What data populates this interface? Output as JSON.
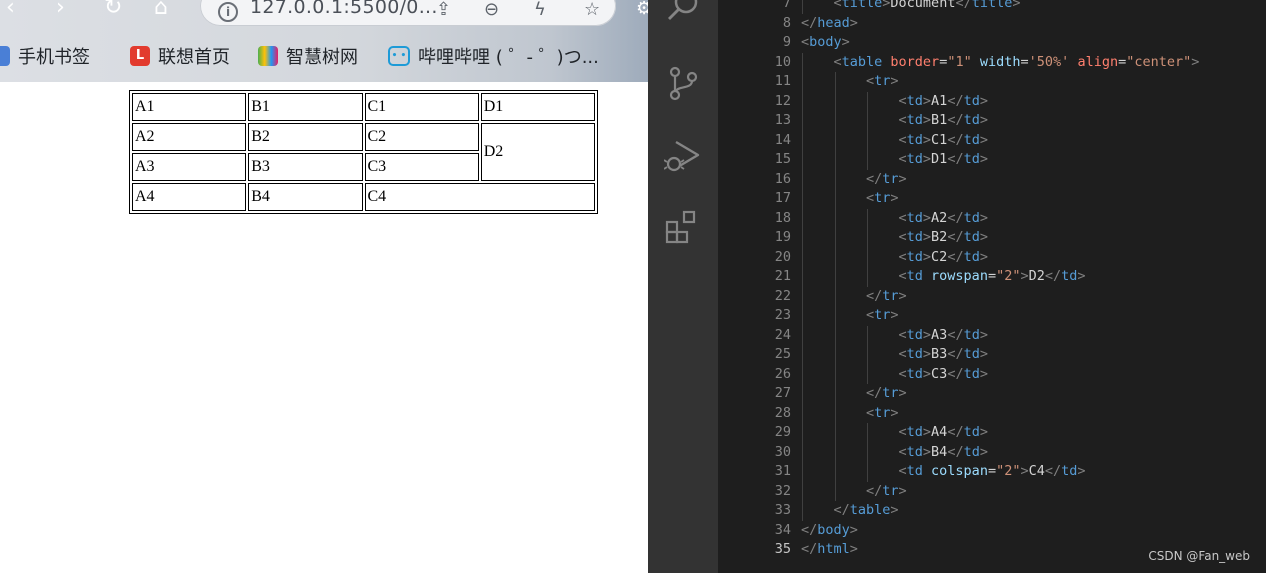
{
  "browser": {
    "url": "127.0.0.1:5500/0...",
    "bookmarks": [
      {
        "label": "手机书签",
        "icon": "bookmark-icon"
      },
      {
        "label": "联想首页",
        "icon": "lenovo-icon",
        "glyph": "L"
      },
      {
        "label": "智慧树网",
        "icon": "zhihuishu-icon"
      },
      {
        "label": "哔哩哔哩 ( ゜- ゜)つ...",
        "icon": "bilibili-icon",
        "glyph": "• •"
      }
    ],
    "table": {
      "rows": [
        [
          "A1",
          "B1",
          "C1",
          "D1"
        ],
        [
          "A2",
          "B2",
          "C2",
          "D2"
        ],
        [
          "A3",
          "B3",
          "C3"
        ],
        [
          "A4",
          "B4",
          "C4"
        ]
      ]
    }
  },
  "editor": {
    "current_line": "35",
    "lines": [
      {
        "no": "7",
        "indent": 1,
        "tokens": [
          [
            "brk",
            "<"
          ],
          [
            "tag",
            "title"
          ],
          [
            "brk",
            ">"
          ],
          [
            "text",
            "Document"
          ],
          [
            "brk",
            "</"
          ],
          [
            "tag",
            "title"
          ],
          [
            "brk",
            ">"
          ]
        ]
      },
      {
        "no": "8",
        "indent": 0,
        "tokens": [
          [
            "brk",
            "</"
          ],
          [
            "tag",
            "head"
          ],
          [
            "brk",
            ">"
          ]
        ]
      },
      {
        "no": "9",
        "indent": 0,
        "tokens": [
          [
            "brk",
            "<"
          ],
          [
            "tag",
            "body"
          ],
          [
            "brk",
            ">"
          ]
        ]
      },
      {
        "no": "10",
        "indent": 1,
        "tokens": [
          [
            "brk",
            "<"
          ],
          [
            "tag",
            "table"
          ],
          [
            "text",
            " "
          ],
          [
            "attr",
            "border"
          ],
          [
            "text",
            "="
          ],
          [
            "str",
            "\"1\""
          ],
          [
            "text",
            " "
          ],
          [
            "attr2",
            "width"
          ],
          [
            "text",
            "="
          ],
          [
            "str",
            "'50%'"
          ],
          [
            "text",
            " "
          ],
          [
            "attr",
            "align"
          ],
          [
            "text",
            "="
          ],
          [
            "str",
            "\"center\""
          ],
          [
            "brk",
            ">"
          ]
        ]
      },
      {
        "no": "11",
        "indent": 2,
        "tokens": [
          [
            "brk",
            "<"
          ],
          [
            "tag",
            "tr"
          ],
          [
            "brk",
            ">"
          ]
        ]
      },
      {
        "no": "12",
        "indent": 3,
        "tokens": [
          [
            "brk",
            "<"
          ],
          [
            "tag",
            "td"
          ],
          [
            "brk",
            ">"
          ],
          [
            "text",
            "A1"
          ],
          [
            "brk",
            "</"
          ],
          [
            "tag",
            "td"
          ],
          [
            "brk",
            ">"
          ]
        ]
      },
      {
        "no": "13",
        "indent": 3,
        "tokens": [
          [
            "brk",
            "<"
          ],
          [
            "tag",
            "td"
          ],
          [
            "brk",
            ">"
          ],
          [
            "text",
            "B1"
          ],
          [
            "brk",
            "</"
          ],
          [
            "tag",
            "td"
          ],
          [
            "brk",
            ">"
          ]
        ]
      },
      {
        "no": "14",
        "indent": 3,
        "tokens": [
          [
            "brk",
            "<"
          ],
          [
            "tag",
            "td"
          ],
          [
            "brk",
            ">"
          ],
          [
            "text",
            "C1"
          ],
          [
            "brk",
            "</"
          ],
          [
            "tag",
            "td"
          ],
          [
            "brk",
            ">"
          ]
        ]
      },
      {
        "no": "15",
        "indent": 3,
        "tokens": [
          [
            "brk",
            "<"
          ],
          [
            "tag",
            "td"
          ],
          [
            "brk",
            ">"
          ],
          [
            "text",
            "D1"
          ],
          [
            "brk",
            "</"
          ],
          [
            "tag",
            "td"
          ],
          [
            "brk",
            ">"
          ]
        ]
      },
      {
        "no": "16",
        "indent": 2,
        "tokens": [
          [
            "brk",
            "</"
          ],
          [
            "tag",
            "tr"
          ],
          [
            "brk",
            ">"
          ]
        ]
      },
      {
        "no": "17",
        "indent": 2,
        "tokens": [
          [
            "brk",
            "<"
          ],
          [
            "tag",
            "tr"
          ],
          [
            "brk",
            ">"
          ]
        ]
      },
      {
        "no": "18",
        "indent": 3,
        "tokens": [
          [
            "brk",
            "<"
          ],
          [
            "tag",
            "td"
          ],
          [
            "brk",
            ">"
          ],
          [
            "text",
            "A2"
          ],
          [
            "brk",
            "</"
          ],
          [
            "tag",
            "td"
          ],
          [
            "brk",
            ">"
          ]
        ]
      },
      {
        "no": "19",
        "indent": 3,
        "tokens": [
          [
            "brk",
            "<"
          ],
          [
            "tag",
            "td"
          ],
          [
            "brk",
            ">"
          ],
          [
            "text",
            "B2"
          ],
          [
            "brk",
            "</"
          ],
          [
            "tag",
            "td"
          ],
          [
            "brk",
            ">"
          ]
        ]
      },
      {
        "no": "20",
        "indent": 3,
        "tokens": [
          [
            "brk",
            "<"
          ],
          [
            "tag",
            "td"
          ],
          [
            "brk",
            ">"
          ],
          [
            "text",
            "C2"
          ],
          [
            "brk",
            "</"
          ],
          [
            "tag",
            "td"
          ],
          [
            "brk",
            ">"
          ]
        ]
      },
      {
        "no": "21",
        "indent": 3,
        "tokens": [
          [
            "brk",
            "<"
          ],
          [
            "tag",
            "td"
          ],
          [
            "text",
            " "
          ],
          [
            "attr2",
            "rowspan"
          ],
          [
            "text",
            "="
          ],
          [
            "str",
            "\"2\""
          ],
          [
            "brk",
            ">"
          ],
          [
            "text",
            "D2"
          ],
          [
            "brk",
            "</"
          ],
          [
            "tag",
            "td"
          ],
          [
            "brk",
            ">"
          ]
        ]
      },
      {
        "no": "22",
        "indent": 2,
        "tokens": [
          [
            "brk",
            "</"
          ],
          [
            "tag",
            "tr"
          ],
          [
            "brk",
            ">"
          ]
        ]
      },
      {
        "no": "23",
        "indent": 2,
        "tokens": [
          [
            "brk",
            "<"
          ],
          [
            "tag",
            "tr"
          ],
          [
            "brk",
            ">"
          ]
        ]
      },
      {
        "no": "24",
        "indent": 3,
        "tokens": [
          [
            "brk",
            "<"
          ],
          [
            "tag",
            "td"
          ],
          [
            "brk",
            ">"
          ],
          [
            "text",
            "A3"
          ],
          [
            "brk",
            "</"
          ],
          [
            "tag",
            "td"
          ],
          [
            "brk",
            ">"
          ]
        ]
      },
      {
        "no": "25",
        "indent": 3,
        "tokens": [
          [
            "brk",
            "<"
          ],
          [
            "tag",
            "td"
          ],
          [
            "brk",
            ">"
          ],
          [
            "text",
            "B3"
          ],
          [
            "brk",
            "</"
          ],
          [
            "tag",
            "td"
          ],
          [
            "brk",
            ">"
          ]
        ]
      },
      {
        "no": "26",
        "indent": 3,
        "tokens": [
          [
            "brk",
            "<"
          ],
          [
            "tag",
            "td"
          ],
          [
            "brk",
            ">"
          ],
          [
            "text",
            "C3"
          ],
          [
            "brk",
            "</"
          ],
          [
            "tag",
            "td"
          ],
          [
            "brk",
            ">"
          ]
        ]
      },
      {
        "no": "27",
        "indent": 2,
        "tokens": [
          [
            "brk",
            "</"
          ],
          [
            "tag",
            "tr"
          ],
          [
            "brk",
            ">"
          ]
        ]
      },
      {
        "no": "28",
        "indent": 2,
        "tokens": [
          [
            "brk",
            "<"
          ],
          [
            "tag",
            "tr"
          ],
          [
            "brk",
            ">"
          ]
        ]
      },
      {
        "no": "29",
        "indent": 3,
        "tokens": [
          [
            "brk",
            "<"
          ],
          [
            "tag",
            "td"
          ],
          [
            "brk",
            ">"
          ],
          [
            "text",
            "A4"
          ],
          [
            "brk",
            "</"
          ],
          [
            "tag",
            "td"
          ],
          [
            "brk",
            ">"
          ]
        ]
      },
      {
        "no": "30",
        "indent": 3,
        "tokens": [
          [
            "brk",
            "<"
          ],
          [
            "tag",
            "td"
          ],
          [
            "brk",
            ">"
          ],
          [
            "text",
            "B4"
          ],
          [
            "brk",
            "</"
          ],
          [
            "tag",
            "td"
          ],
          [
            "brk",
            ">"
          ]
        ]
      },
      {
        "no": "31",
        "indent": 3,
        "tokens": [
          [
            "brk",
            "<"
          ],
          [
            "tag",
            "td"
          ],
          [
            "text",
            " "
          ],
          [
            "attr2",
            "colspan"
          ],
          [
            "text",
            "="
          ],
          [
            "str",
            "\"2\""
          ],
          [
            "brk",
            ">"
          ],
          [
            "text",
            "C4"
          ],
          [
            "brk",
            "</"
          ],
          [
            "tag",
            "td"
          ],
          [
            "brk",
            ">"
          ]
        ]
      },
      {
        "no": "32",
        "indent": 2,
        "tokens": [
          [
            "brk",
            "</"
          ],
          [
            "tag",
            "tr"
          ],
          [
            "brk",
            ">"
          ]
        ]
      },
      {
        "no": "33",
        "indent": 1,
        "tokens": [
          [
            "brk",
            "</"
          ],
          [
            "tag",
            "table"
          ],
          [
            "brk",
            ">"
          ]
        ]
      },
      {
        "no": "34",
        "indent": 0,
        "tokens": [
          [
            "brk",
            "</"
          ],
          [
            "tag",
            "body"
          ],
          [
            "brk",
            ">"
          ]
        ]
      },
      {
        "no": "35",
        "indent": 0,
        "tokens": [
          [
            "brk",
            "</"
          ],
          [
            "tag",
            "html"
          ],
          [
            "brk",
            ">"
          ]
        ]
      }
    ]
  },
  "watermark": "CSDN @Fan_web",
  "colors": {
    "editor_bg": "#1e1e1e",
    "activity_bar": "#333333",
    "tag": "#569cd6",
    "attr": "#ff7f6e",
    "attr_alt": "#9cdcfe",
    "string": "#ce9178",
    "bracket": "#808080"
  }
}
